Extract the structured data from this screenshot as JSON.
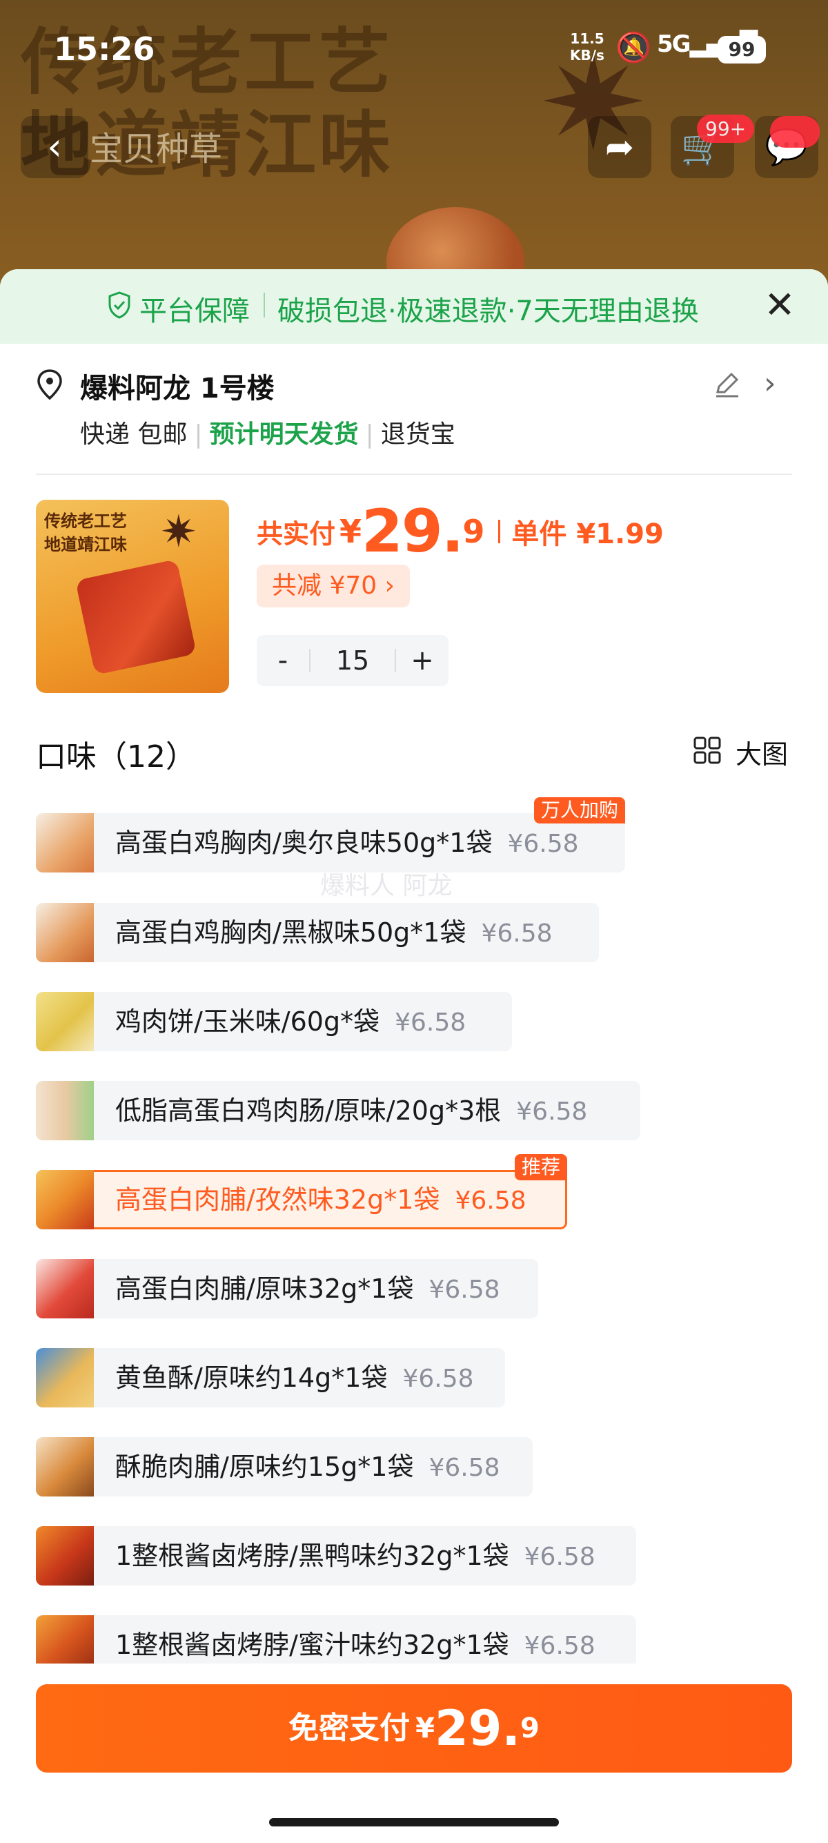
{
  "status_bar": {
    "time": "15:26",
    "speed_value": "11.5",
    "speed_unit": "KB/s",
    "network": "5G",
    "battery": "99"
  },
  "background": {
    "banner_line1": "传统老工艺",
    "banner_line2": "地道靖江味",
    "nav_title": "宝贝种草",
    "cart_count": "99+"
  },
  "guarantee": {
    "title": "平台保障",
    "text": "破损包退·极速退款·7天无理由退换"
  },
  "address": {
    "name": "爆料阿龙 1号楼",
    "ship_express": "快递 包邮",
    "ship_eta": "预计明天发货",
    "ship_return": "退货宝"
  },
  "product": {
    "thumb_text1": "传统老工艺",
    "thumb_text2": "地道靖江味",
    "total_label": "共实付",
    "currency": "¥",
    "total_int": "29.",
    "total_dec": "9",
    "unit_label": "单件 ¥1.99",
    "discount": "共减 ¥70 ›",
    "quantity": "15",
    "minus": "-",
    "plus": "+"
  },
  "flavor_section": {
    "title": "口味（12）",
    "view_label": "大图"
  },
  "watermark": "爆料人 阿龙",
  "flavors": [
    {
      "name": "高蛋白鸡胸肉/奥尔良味50g*1袋",
      "price": "¥6.58",
      "badge": "万人加购"
    },
    {
      "name": "高蛋白鸡胸肉/黑椒味50g*1袋",
      "price": "¥6.58"
    },
    {
      "name": "鸡肉饼/玉米味/60g*袋",
      "price": "¥6.58"
    },
    {
      "name": "低脂高蛋白鸡肉肠/原味/20g*3根",
      "price": "¥6.58"
    },
    {
      "name": "高蛋白肉脯/孜然味32g*1袋",
      "price": "¥6.58",
      "badge": "推荐"
    },
    {
      "name": "高蛋白肉脯/原味32g*1袋",
      "price": "¥6.58"
    },
    {
      "name": "黄鱼酥/原味约14g*1袋",
      "price": "¥6.58"
    },
    {
      "name": "酥脆肉脯/原味约15g*1袋",
      "price": "¥6.58"
    },
    {
      "name": "1整根酱卤烤脖/黑鸭味约32g*1袋",
      "price": "¥6.58"
    },
    {
      "name": "1整根酱卤烤脖/蜜汁味约32g*1袋",
      "price": "¥6.58"
    }
  ],
  "pay": {
    "label": "免密支付",
    "currency": "¥",
    "amount_int": "29.",
    "amount_dec": "9"
  },
  "colors": {
    "accent": "#ff5a1f",
    "green": "#1ca34a"
  }
}
